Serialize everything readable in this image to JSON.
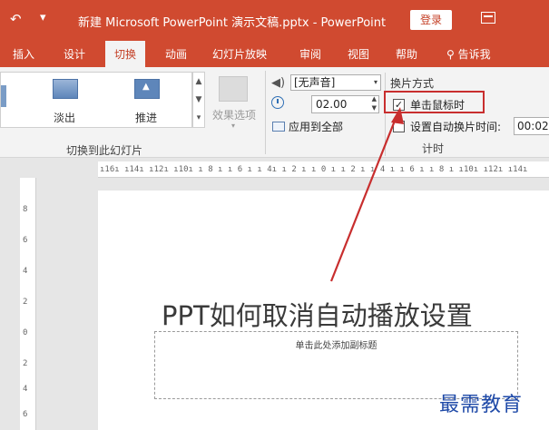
{
  "titlebar": {
    "undo_icon": "undo-icon",
    "qat_icon": "▾",
    "title": "新建 Microsoft PowerPoint 演示文稿.pptx  -  PowerPoint",
    "login_label": "登录",
    "ribbon_display_icon": "ribbon-display-options-icon",
    "accent": "#d04a30"
  },
  "tabs": {
    "insert": "插入",
    "design": "设计",
    "transitions": "切换",
    "animations": "动画",
    "slideshow": "幻灯片放映",
    "review": "审阅",
    "view": "视图",
    "help": "帮助",
    "tellme": "告诉我",
    "active": "transitions"
  },
  "ribbon": {
    "gallery": {
      "items": [
        {
          "label": "淡出",
          "icon": "fade-transition-icon"
        },
        {
          "label": "推进",
          "icon": "push-transition-icon"
        }
      ],
      "scroll_up": "▲",
      "scroll_down": "▼",
      "more": "▾"
    },
    "effect_options_label": "效果选项",
    "effect_options_chevron": "▾",
    "group_label": "切换到此幻灯片",
    "timing": {
      "sound_value": "[无声音]",
      "dropdown_arrow": "▾",
      "duration_value": "02.00",
      "spin_up": "▲",
      "spin_down": "▼",
      "apply_all_label": "应用到全部",
      "advance_header": "换片方式",
      "on_click_label": "单击鼠标时",
      "on_click_checked": true,
      "check_mark": "✓",
      "after_label": "设置自动换片时间:",
      "after_checked": false,
      "after_value": "00:02",
      "group_label_partial": "计时"
    }
  },
  "rulers": {
    "horizontal": "ı16ı ı14ı ı12ı ı10ı ı 8 ı ı 6 ı ı 4ı ı 2 ı ı 0 ı ı 2 ı ı 4 ı ı 6 ı ı 8 ı ı10ı ı12ı ı14ı",
    "vertical_marks": [
      "8",
      "6",
      "4",
      "2",
      "0",
      "2",
      "4",
      "6"
    ]
  },
  "slide": {
    "title": "PPT如何取消自动播放设置",
    "subtitle_placeholder": "单击此处添加副标题"
  },
  "watermark": "最需教育",
  "annotation": {
    "highlight_color": "#c82e2e"
  }
}
